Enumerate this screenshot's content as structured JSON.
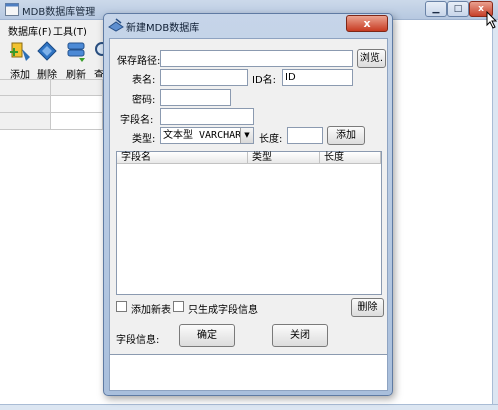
{
  "main_window": {
    "title": "MDB数据库管理",
    "controls": {
      "minimize": "▁",
      "maximize": "□",
      "close": "x"
    },
    "menu": [
      "数据库(F)",
      "工具(T)"
    ],
    "toolbar": [
      {
        "label": "添加",
        "icon": "add-db-icon"
      },
      {
        "label": "删除",
        "icon": "delete-db-icon"
      },
      {
        "label": "刷新",
        "icon": "refresh-icon"
      },
      {
        "label": "查",
        "icon": "query-icon"
      }
    ]
  },
  "dialog": {
    "title": "新建MDB数据库",
    "close_label": "x",
    "save_path_label": "保存路径:",
    "save_path_value": "",
    "browse_label": "浏览.",
    "table_name_label": "表名:",
    "table_name_value": "",
    "id_name_label": "ID名:",
    "id_name_value": "ID",
    "password_label": "密码:",
    "password_value": "",
    "field_name_label": "字段名:",
    "field_name_value": "",
    "type_label": "类型:",
    "type_value": "文本型 VARCHAR",
    "length_label": "长度:",
    "length_value": "",
    "add_label": "添加",
    "columns": [
      "字段名",
      "类型",
      "长度"
    ],
    "add_new_table_label": "添加新表",
    "only_field_info_label": "只生成字段信息",
    "delete_label": "删除",
    "field_info_label": "字段信息:",
    "ok_label": "确定",
    "close_button_label": "关闭"
  }
}
